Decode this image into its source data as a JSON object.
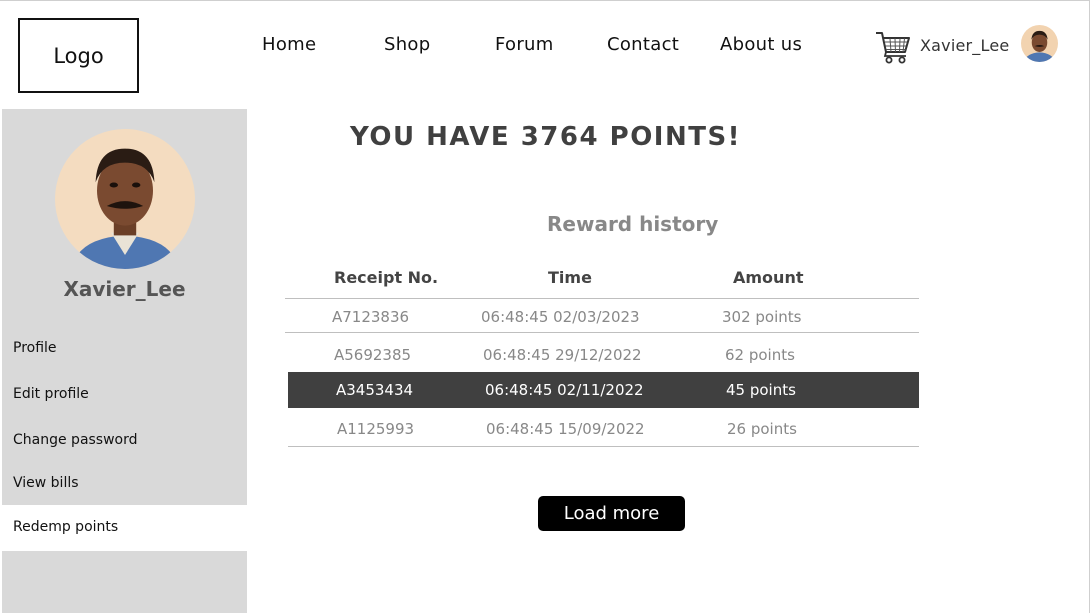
{
  "header": {
    "logo": "Logo",
    "nav": [
      "Home",
      "Shop",
      "Forum",
      "Contact",
      "About us"
    ],
    "username": "Xavier_Lee"
  },
  "sidebar": {
    "username": "Xavier_Lee",
    "menu": [
      "Profile",
      "Edit profile",
      "Change password",
      "View bills",
      "Redemp points"
    ],
    "active_item": "Redemp points"
  },
  "main": {
    "points_title": "YOU HAVE 3764 POINTS!",
    "history_title": "Reward history",
    "columns": [
      "Receipt No.",
      "Time",
      "Amount"
    ],
    "rows": [
      {
        "receipt": "A7123836",
        "time": "06:48:45 02/03/2023",
        "amount": "302 points"
      },
      {
        "receipt": "A5692385",
        "time": "06:48:45 29/12/2022",
        "amount": "62 points"
      },
      {
        "receipt": "A3453434",
        "time": "06:48:45 02/11/2022",
        "amount": "45 points"
      },
      {
        "receipt": "A1125993",
        "time": "06:48:45 15/09/2022",
        "amount": "26 points"
      }
    ],
    "selected_row": "A3453434",
    "load_more": "Load more"
  },
  "icons": {
    "cart": "shopping-cart-icon",
    "avatar": "user-avatar"
  },
  "colors": {
    "sidebar_bg": "#d9d9d9",
    "selected_row_bg": "#404040",
    "button_bg": "#000000"
  }
}
